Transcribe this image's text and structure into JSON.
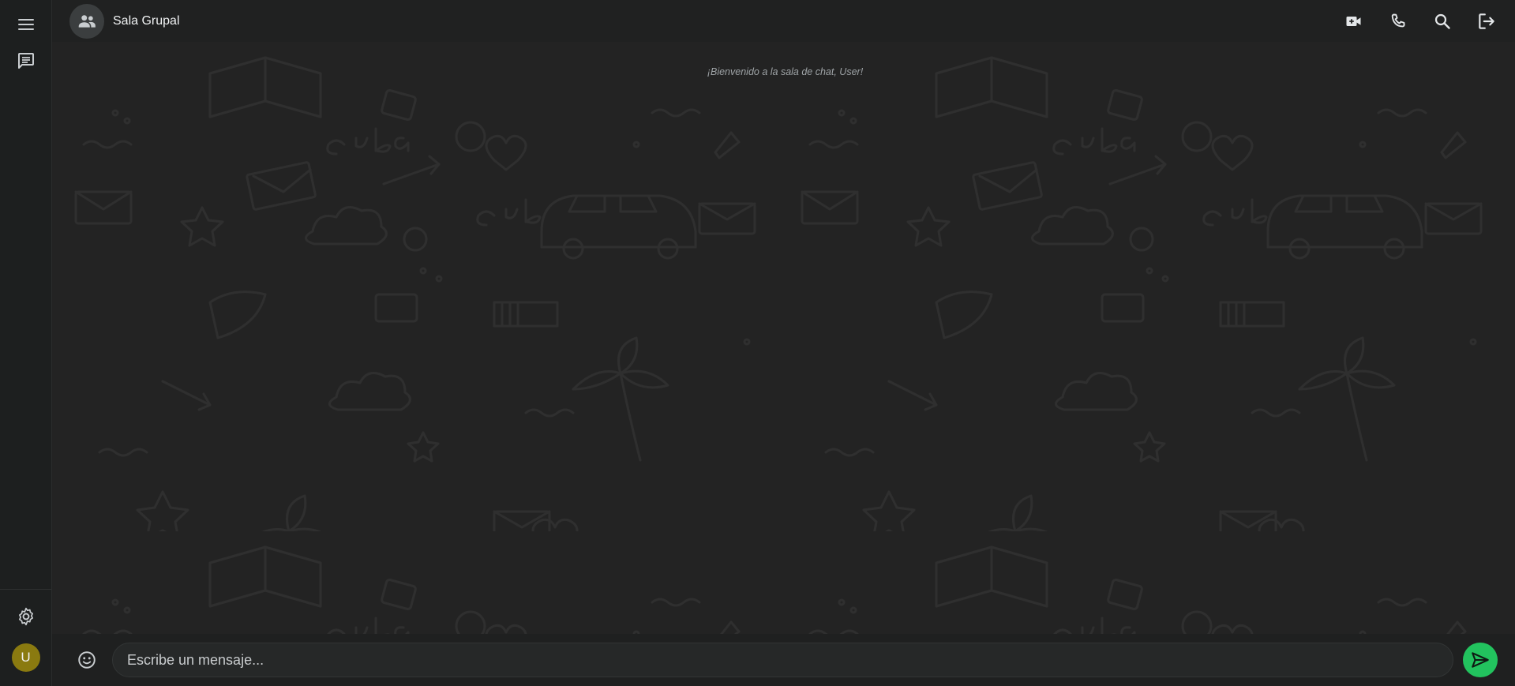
{
  "rail": {
    "menu_icon": "menu-icon",
    "chats_icon": "chat-icon",
    "settings_icon": "gear-icon",
    "user_avatar_initial": "U"
  },
  "header": {
    "group_icon": "group-icon",
    "title": "Sala Grupal",
    "actions": [
      "video-call-icon",
      "phone-icon",
      "search-icon",
      "logout-icon"
    ]
  },
  "chat": {
    "welcome_message": "¡Bienvenido a la sala de chat, User!"
  },
  "composer": {
    "emoji_icon": "emoji-icon",
    "placeholder": "Escribe un mensaje...",
    "value": "",
    "send_icon": "send-icon"
  },
  "colors": {
    "accent": "#22c35e",
    "avatar": "#8a7a10",
    "background": "#232323"
  }
}
